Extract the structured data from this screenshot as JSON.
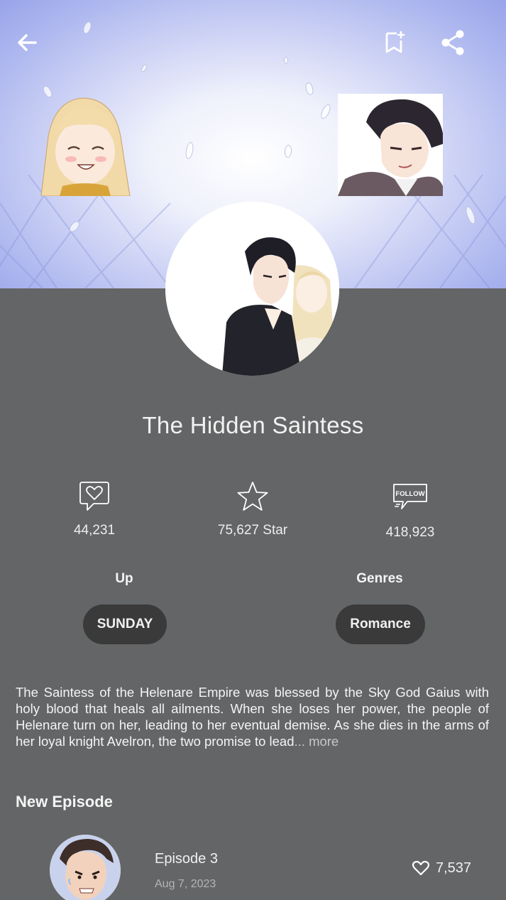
{
  "header": {
    "back_icon": "arrow-left-icon",
    "bookmark_icon": "bookmark-add-icon",
    "share_icon": "share-icon"
  },
  "series": {
    "title": "The Hidden Saintess"
  },
  "stats": {
    "comments": {
      "icon": "comment-heart-icon",
      "value": "44,231"
    },
    "stars": {
      "icon": "star-icon",
      "value": "75,627 Star"
    },
    "follows": {
      "icon": "follow-icon",
      "icon_text": "FOLLOW",
      "value": "418,923"
    }
  },
  "meta": {
    "up_label": "Up",
    "up_value": "SUNDAY",
    "genres_label": "Genres",
    "genre_value": "Romance"
  },
  "description": {
    "text": "The Saintess of the Helenare Empire was blessed by the Sky God Gaius with holy blood that heals all ailments. When she loses her power, the people of Helenare turn on her, leading to her eventual demise. As she dies in the arms of her loyal knight Avelron, the two promise to lead",
    "ellipsis": "...",
    "more_label": "more"
  },
  "new_episode": {
    "section_title": "New Episode",
    "episodes": [
      {
        "title": "Episode 3",
        "date": "Aug 7, 2023",
        "likes": "7,537"
      }
    ]
  },
  "colors": {
    "background": "#646566",
    "pill": "#3a3a3a",
    "banner_blue": "#a9b3ee"
  }
}
